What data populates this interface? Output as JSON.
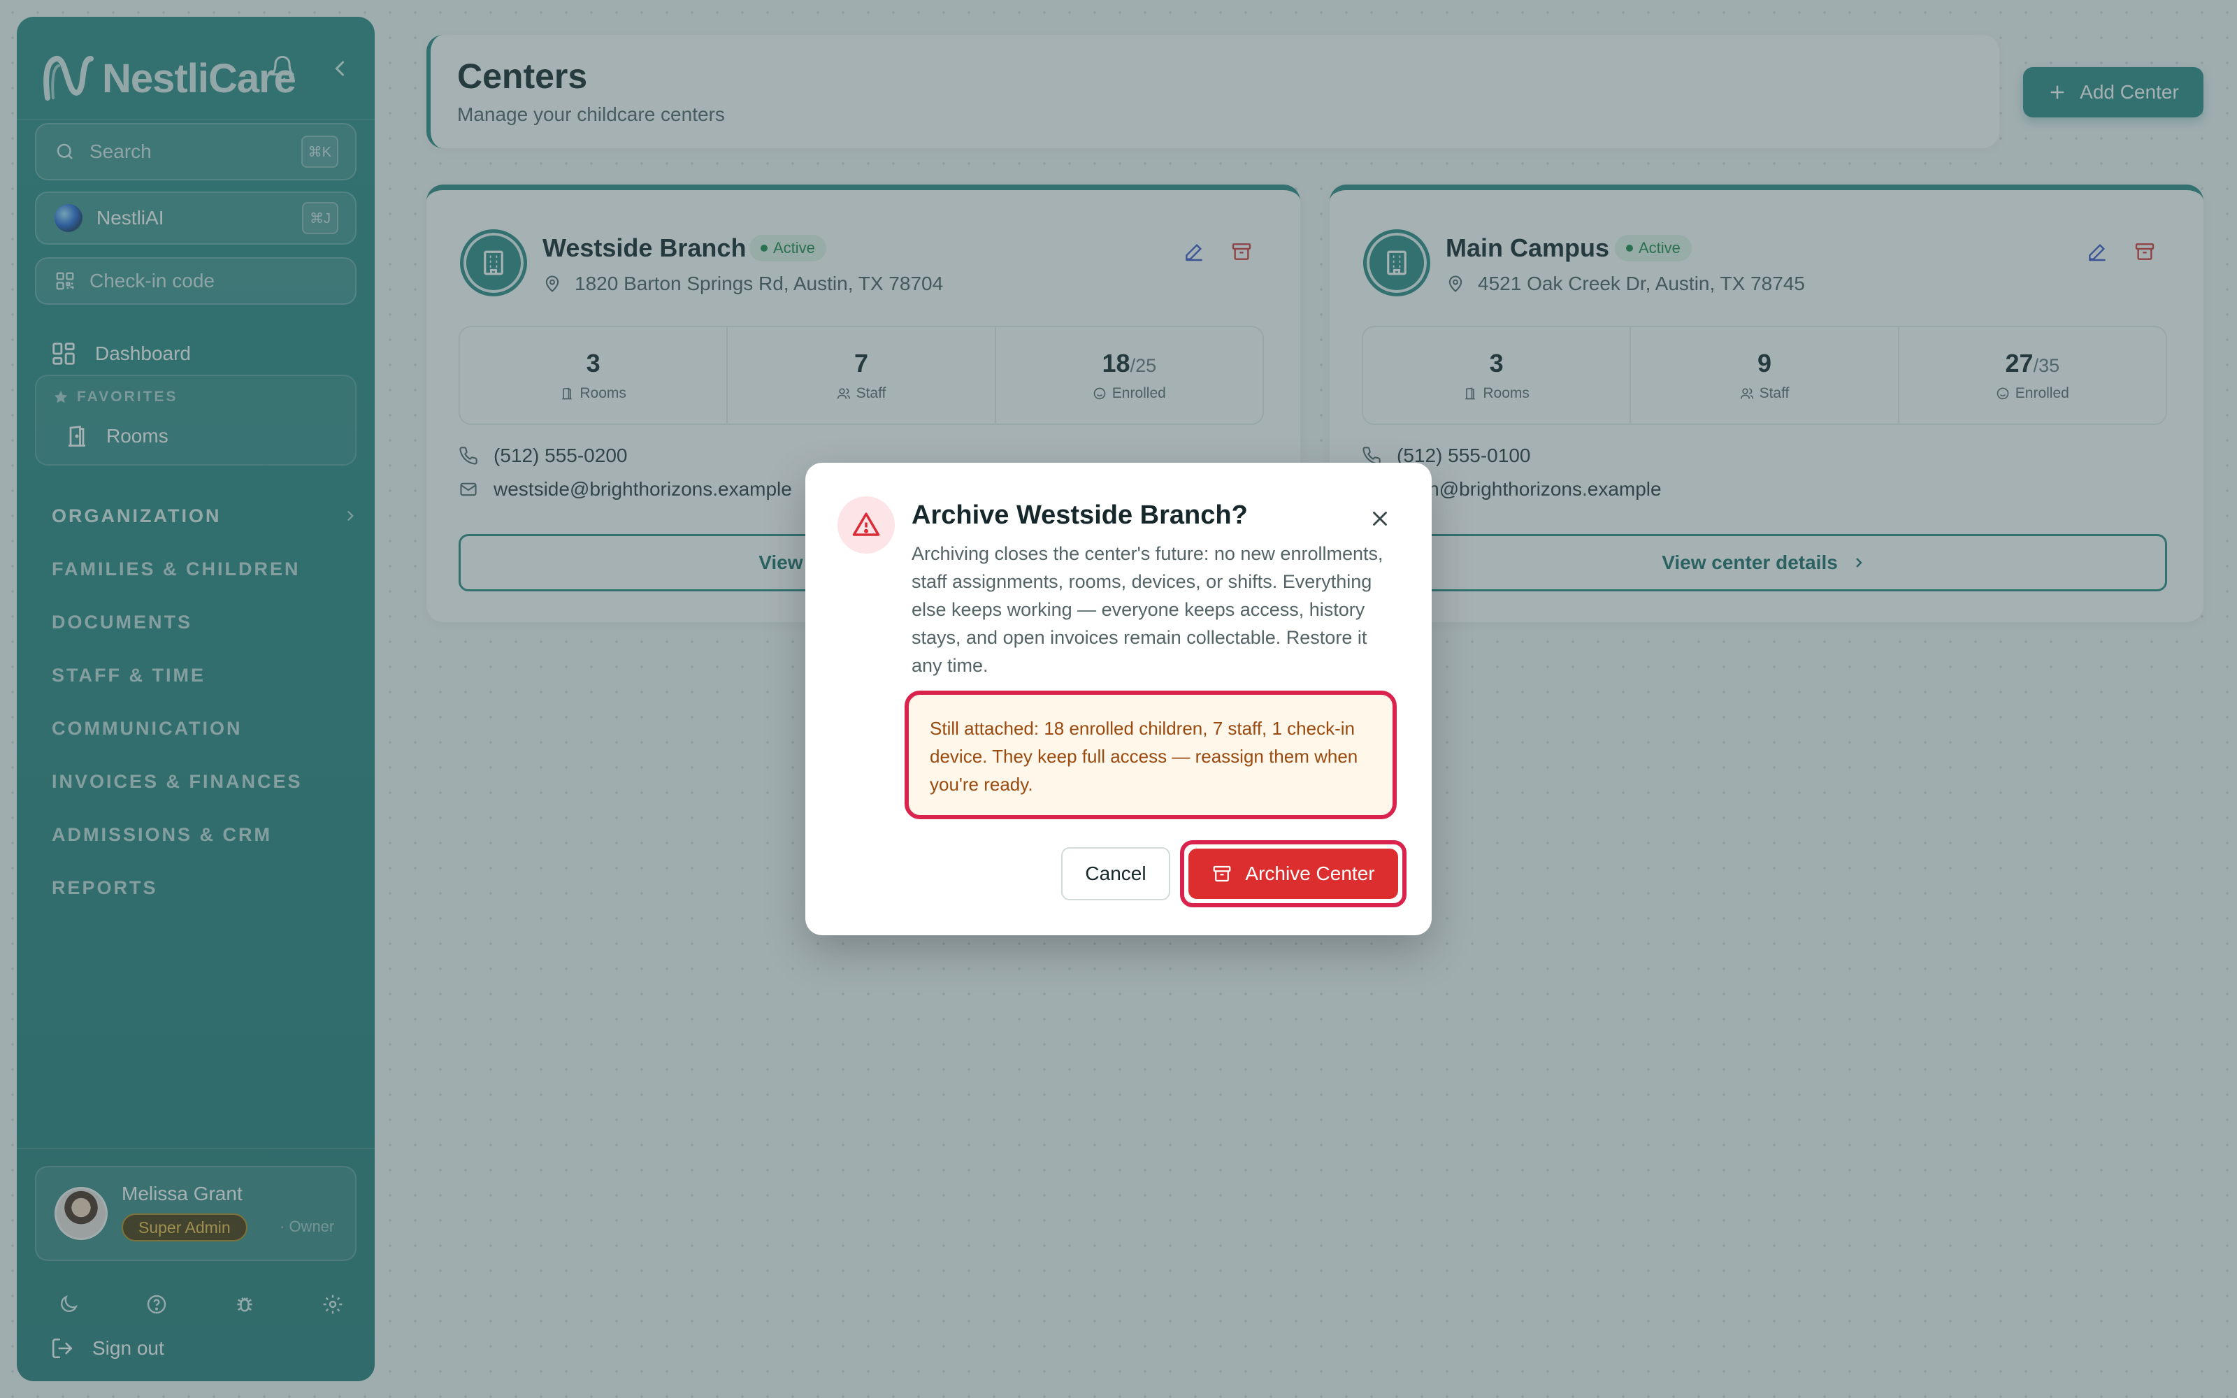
{
  "app": {
    "brand": "NestliCare"
  },
  "sidebar": {
    "search_placeholder": "Search",
    "search_shortcut": "⌘K",
    "ai_label": "NestliAI",
    "ai_shortcut": "⌘J",
    "checkin_label": "Check-in code",
    "dashboard_label": "Dashboard",
    "favorites_heading": "FAVORITES",
    "favorite_items": [
      "Rooms"
    ],
    "sections": [
      "ORGANIZATION",
      "FAMILIES & CHILDREN",
      "DOCUMENTS",
      "STAFF & TIME",
      "COMMUNICATION",
      "INVOICES & FINANCES",
      "ADMISSIONS & CRM",
      "REPORTS"
    ],
    "user": {
      "name": "Melissa Grant",
      "role": "Super Admin",
      "role_sub": "· Owner"
    },
    "signout_label": "Sign out"
  },
  "header": {
    "title": "Centers",
    "subtitle": "Manage your childcare centers",
    "add_button": "Add Center"
  },
  "centers": [
    {
      "name": "Westside Branch",
      "status": "Active",
      "address": "1820 Barton Springs Rd, Austin, TX 78704",
      "rooms": "3",
      "rooms_label": "Rooms",
      "staff": "7",
      "staff_label": "Staff",
      "enrolled": "18",
      "capacity": "/25",
      "enrolled_label": "Enrolled",
      "phone": "(512) 555-0200",
      "email": "westside@brighthorizons.example",
      "view_label": "View center details"
    },
    {
      "name": "Main Campus",
      "status": "Active",
      "address": "4521 Oak Creek Dr, Austin, TX 78745",
      "rooms": "3",
      "rooms_label": "Rooms",
      "staff": "9",
      "staff_label": "Staff",
      "enrolled": "27",
      "capacity": "/35",
      "enrolled_label": "Enrolled",
      "phone": "(512) 555-0100",
      "email": "main@brighthorizons.example",
      "view_label": "View center details"
    }
  ],
  "modal": {
    "title": "Archive Westside Branch?",
    "body": "Archiving closes the center's future: no new enrollments, staff assignments, rooms, devices, or shifts. Everything else keeps working — everyone keeps access, history stays, and open invoices remain collectable. Restore it any time.",
    "alert": "Still attached: 18 enrolled children, 7 staff, 1 check-in device. They keep full access — reassign them when you're ready.",
    "cancel_label": "Cancel",
    "confirm_label": "Archive Center"
  },
  "colors": {
    "brand": "#2e8b86",
    "danger": "#dc2e2e",
    "highlight": "#d9234c",
    "active": "#1f8a4c"
  }
}
